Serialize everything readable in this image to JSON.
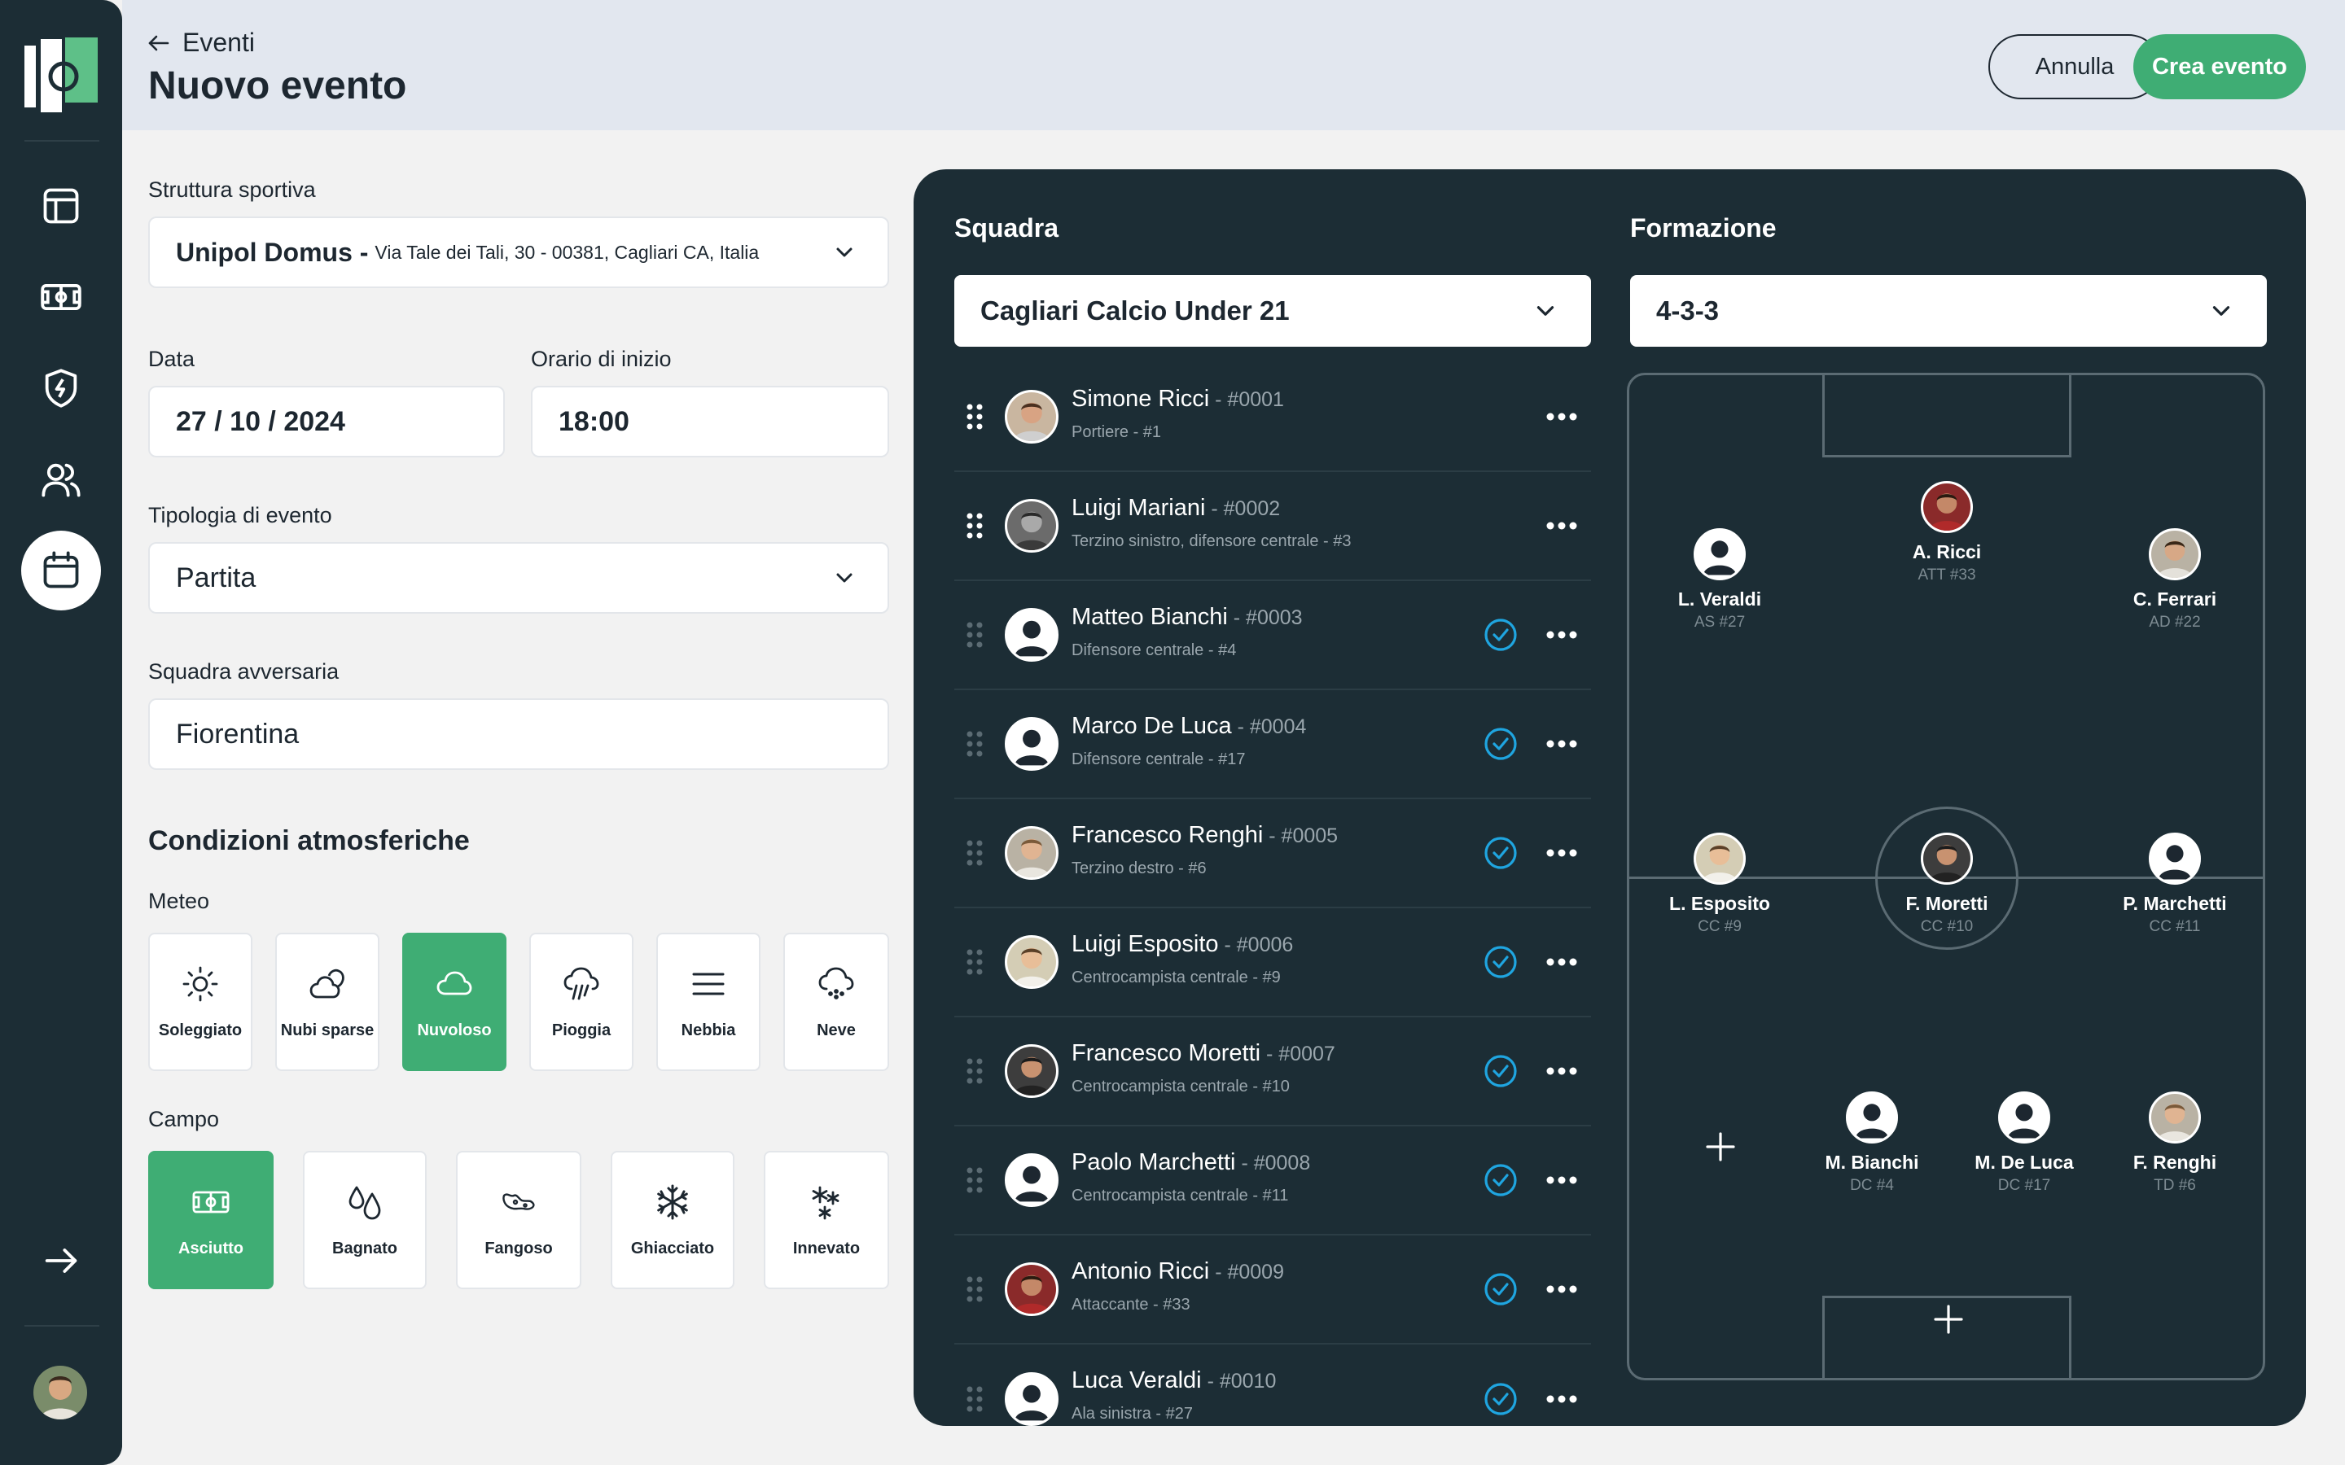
{
  "header": {
    "back_label": "Eventi",
    "title": "Nuovo evento",
    "cancel_label": "Annulla",
    "create_label": "Crea evento"
  },
  "form": {
    "struttura": {
      "label": "Struttura sportiva",
      "name": "Unipol Domus -",
      "address": "Via Tale dei Tali, 30 - 00381, Cagliari CA, Italia"
    },
    "data": {
      "label": "Data",
      "value": "27 / 10 / 2024"
    },
    "orario": {
      "label": "Orario di inizio",
      "value": "18:00"
    },
    "tipologia": {
      "label": "Tipologia di evento",
      "value": "Partita"
    },
    "avversaria": {
      "label": "Squadra avversaria",
      "value": "Fiorentina"
    },
    "condizioni_title": "Condizioni atmosferiche",
    "meteo": {
      "label": "Meteo",
      "options": [
        {
          "label": "Soleggiato",
          "icon": "sun-icon",
          "active": false
        },
        {
          "label": "Nubi sparse",
          "icon": "partly-cloudy-icon",
          "active": false
        },
        {
          "label": "Nuvoloso",
          "icon": "cloud-icon",
          "active": true
        },
        {
          "label": "Pioggia",
          "icon": "rain-icon",
          "active": false
        },
        {
          "label": "Nebbia",
          "icon": "fog-icon",
          "active": false
        },
        {
          "label": "Neve",
          "icon": "snow-cloud-icon",
          "active": false
        }
      ]
    },
    "campo": {
      "label": "Campo",
      "options": [
        {
          "label": "Asciutto",
          "icon": "field-icon",
          "active": true
        },
        {
          "label": "Bagnato",
          "icon": "drops-icon",
          "active": false
        },
        {
          "label": "Fangoso",
          "icon": "mud-icon",
          "active": false
        },
        {
          "label": "Ghiacciato",
          "icon": "snowflake-icon",
          "active": false
        },
        {
          "label": "Innevato",
          "icon": "snowflakes-icon",
          "active": false
        }
      ]
    }
  },
  "panel": {
    "squadra_label": "Squadra",
    "squadra_value": "Cagliari Calcio Under 21",
    "formazione_label": "Formazione",
    "formazione_value": "4-3-3",
    "players": [
      {
        "name": "Simone Ricci",
        "num": " - #0001",
        "role": "Portiere - #1",
        "selected": false
      },
      {
        "name": "Luigi Mariani",
        "num": " - #0002",
        "role": "Terzino sinistro, difensore centrale - #3",
        "selected": false
      },
      {
        "name": "Matteo Bianchi",
        "num": " - #0003",
        "role": "Difensore centrale - #4",
        "selected": true
      },
      {
        "name": "Marco De Luca",
        "num": " - #0004",
        "role": "Difensore centrale - #17",
        "selected": true
      },
      {
        "name": "Francesco Renghi",
        "num": " - #0005",
        "role": "Terzino destro - #6",
        "selected": true
      },
      {
        "name": "Luigi Esposito",
        "num": " - #0006",
        "role": "Centrocampista centrale - #9",
        "selected": true
      },
      {
        "name": "Francesco Moretti",
        "num": " - #0007",
        "role": "Centrocampista centrale - #10",
        "selected": true
      },
      {
        "name": "Paolo Marchetti",
        "num": " - #0008",
        "role": "Centrocampista centrale - #11",
        "selected": true
      },
      {
        "name": "Antonio Ricci",
        "num": " - #0009",
        "role": "Attaccante - #33",
        "selected": true
      },
      {
        "name": "Luca Veraldi",
        "num": " - #0010",
        "role": "Ala sinistra - #27",
        "selected": true
      }
    ],
    "formation": {
      "ricci": {
        "name": "A. Ricci",
        "role": "ATT #33"
      },
      "veraldi": {
        "name": "L. Veraldi",
        "role": "AS #27"
      },
      "ferrari": {
        "name": "C. Ferrari",
        "role": "AD #22"
      },
      "esposito": {
        "name": "L. Esposito",
        "role": "CC #9"
      },
      "moretti": {
        "name": "F. Moretti",
        "role": "CC #10"
      },
      "marchetti": {
        "name": "P. Marchetti",
        "role": "CC #11"
      },
      "bianchi": {
        "name": "M. Bianchi",
        "role": "DC #4"
      },
      "deluca": {
        "name": "M.  De Luca",
        "role": "DC #17"
      },
      "renghi": {
        "name": "F. Renghi",
        "role": "TD #6"
      }
    }
  },
  "colors": {
    "accent": "#3fad74",
    "sidebar": "#1c2d35",
    "header": "#e2e7ef",
    "check": "#1fa5e0"
  }
}
